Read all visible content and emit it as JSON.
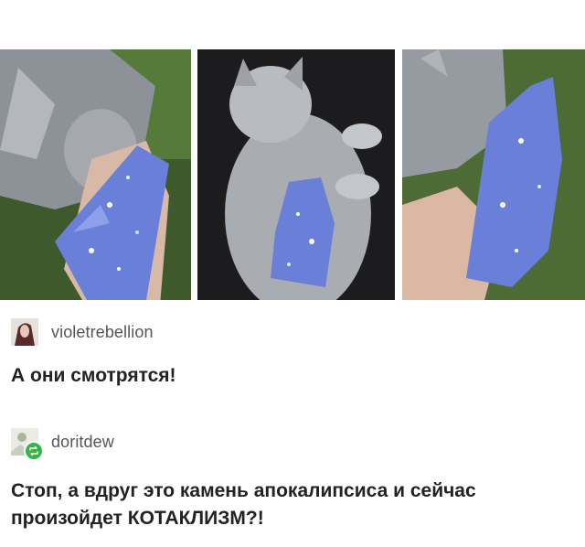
{
  "photos": [
    {
      "icon": "cat-biting-crystal-photo"
    },
    {
      "icon": "cat-lying-with-crystal-photo"
    },
    {
      "icon": "cat-licking-crystal-photo"
    }
  ],
  "post1": {
    "username": "violetrebellion",
    "avatar_icon": "user-avatar",
    "text": "А они смотрятся!"
  },
  "post2": {
    "username": "doritdew",
    "avatar_icon": "user-avatar",
    "badge_icon": "reblog-icon",
    "text_line1": "Стоп, а вдруг это камень апокалипсиса и сейчас",
    "text_line2": "произойдет КОТАКЛИЗМ?!"
  },
  "colors": {
    "crystal": "#6a7fd8",
    "grass": "#4d6b35",
    "fur": "#9a9ea4",
    "badge": "#36b44a"
  }
}
